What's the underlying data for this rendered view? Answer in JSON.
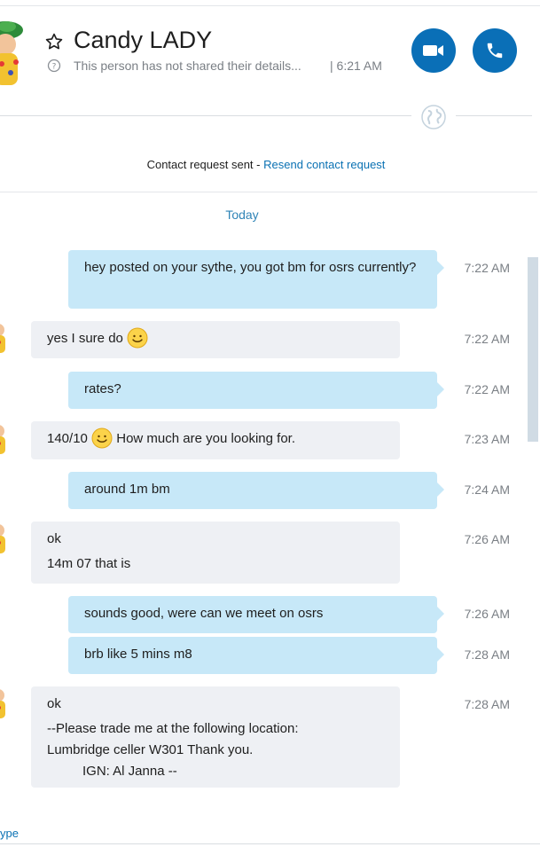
{
  "header": {
    "contact_name": "Candy LADY",
    "subtitle": "This person has not shared their details...",
    "time_label": "| 6:21 AM",
    "icons": {
      "favorite": "star-icon",
      "info": "info-circle-icon",
      "video": "video-camera-icon",
      "call": "phone-icon",
      "presence": "globe-icon"
    },
    "accent": "#0a6fb7"
  },
  "contact_request": {
    "text": "Contact request sent -",
    "link": "Resend contact request"
  },
  "date_divider": "Today",
  "messages": [
    {
      "dir": "out",
      "lines": [
        "hey posted on your sythe, you got bm for osrs currently?"
      ],
      "time": "7:22 AM"
    },
    {
      "dir": "in",
      "lines": [
        "yes I sure do"
      ],
      "emoji": "smile-emoji",
      "time": "7:22 AM"
    },
    {
      "dir": "out",
      "lines": [
        "rates?"
      ],
      "time": "7:22 AM"
    },
    {
      "dir": "in",
      "lines": [
        "140/10",
        "How much are you looking for."
      ],
      "emoji": "smile-emoji",
      "time": "7:23 AM"
    },
    {
      "dir": "out",
      "lines": [
        "around 1m bm"
      ],
      "time": "7:24 AM"
    },
    {
      "dir": "in",
      "lines": [
        "ok",
        "14m 07 that is"
      ],
      "time": "7:26 AM"
    },
    {
      "dir": "out",
      "lines": [
        "sounds good, were can we meet on osrs"
      ],
      "time": "7:26 AM"
    },
    {
      "dir": "out",
      "lines": [
        "brb like 5 mins m8"
      ],
      "time": "7:28 AM"
    },
    {
      "dir": "in",
      "lines": [
        "ok",
        "--Please trade me at the following location:",
        "Lumbridge celler W301 Thank you.",
        "IGN: Al Janna --"
      ],
      "time": "7:28 AM"
    }
  ],
  "footer": {
    "hint": "ype"
  },
  "colors": {
    "outgoing_bubble": "#c7e8f8",
    "incoming_bubble": "#eef0f4",
    "link": "#0a71b3",
    "date_divider": "#2f84b7"
  }
}
